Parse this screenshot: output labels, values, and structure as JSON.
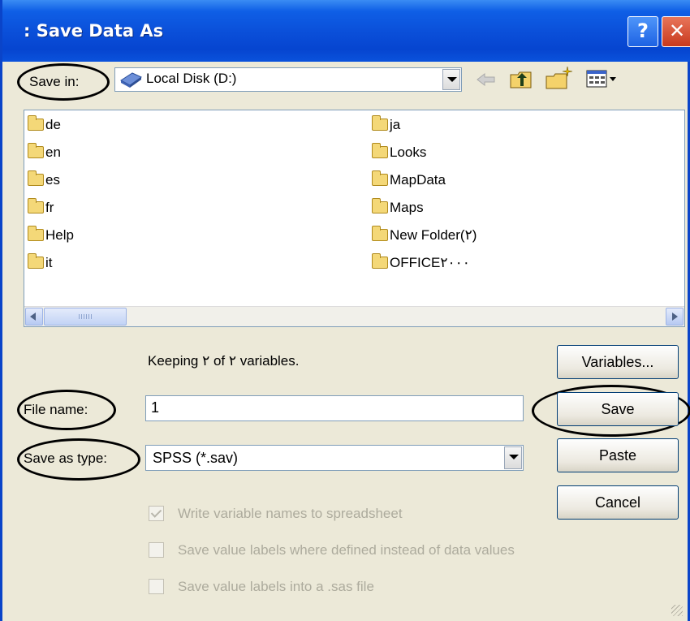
{
  "window": {
    "title": ": Save Data As",
    "help_label": "?",
    "close_label": "✕"
  },
  "save_in": {
    "label": "Save in:",
    "value": "Local Disk (D:)"
  },
  "files": {
    "col1": [
      "de",
      "en",
      "es",
      "fr",
      "Help",
      "it"
    ],
    "col2": [
      "ja",
      "Looks",
      "MapData",
      "Maps",
      "New Folder(۲)",
      "OFFICE۲۰۰۰"
    ]
  },
  "status_text": "Keeping ۲ of ۲ variables.",
  "file_name": {
    "label": "File name:",
    "value": "1"
  },
  "save_as_type": {
    "label": "Save as type:",
    "value": "SPSS (*.sav)"
  },
  "buttons": {
    "variables": "Variables...",
    "save": "Save",
    "paste": "Paste",
    "cancel": "Cancel"
  },
  "options": [
    {
      "label": "Write variable names to spreadsheet",
      "checked": true,
      "enabled": false
    },
    {
      "label": "Save value labels where defined instead of data values",
      "checked": false,
      "enabled": false
    },
    {
      "label": "Save value labels into a .sas file",
      "checked": false,
      "enabled": false
    }
  ]
}
